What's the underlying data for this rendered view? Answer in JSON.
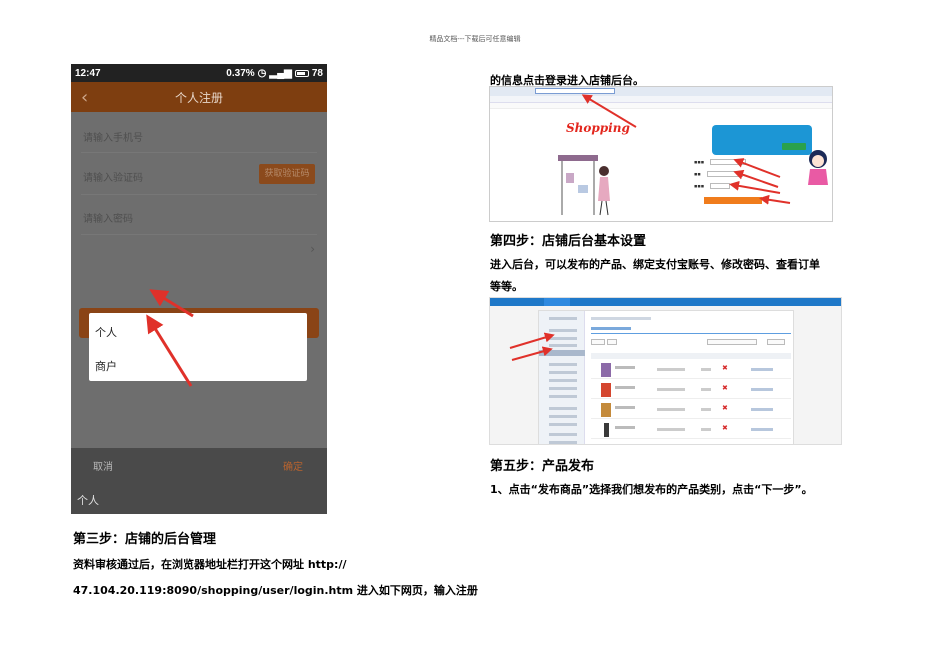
{
  "header_note": "精品文档---下载后可任意编辑",
  "phone": {
    "status_time": "12:47",
    "status_right": "0.37",
    "status_battery": "78",
    "title": "个人注册",
    "back_icon": "chevron-left-icon",
    "phone_placeholder": "请输入手机号",
    "code_placeholder": "请输入验证码",
    "get_code_label": "获取验证码",
    "password_placeholder": "请输入密码",
    "popup_options": [
      "个人",
      "商户"
    ],
    "cancel_label": "取消",
    "confirm_label": "确定",
    "selected_value": "个人",
    "accent_color": "#7e3e10",
    "arrow_color": "#e0312a"
  },
  "left": {
    "step3_title": "第三步：店铺的后台管理",
    "para_line1": "资料审核通过后，在浏览器地址栏打开这个网址 http://",
    "para_line2": "47.104.20.119:8090/shopping/user/login.htm 进入如下网页，输入注册"
  },
  "right": {
    "line_top": "的信息点击登录进入店铺后台。",
    "browser_logo": "Shopping",
    "step4_title": "第四步：店铺后台基本设置",
    "step4_line1": "进入后台，可以发布的产品、绑定支付宝账号、修改密码、查看订单",
    "step4_line2": "等等。",
    "step5_title": "第五步：产品发布",
    "step5_line1": "1、点击“发布商品”选择我们想发布的产品类别，点击“下一步”。"
  }
}
